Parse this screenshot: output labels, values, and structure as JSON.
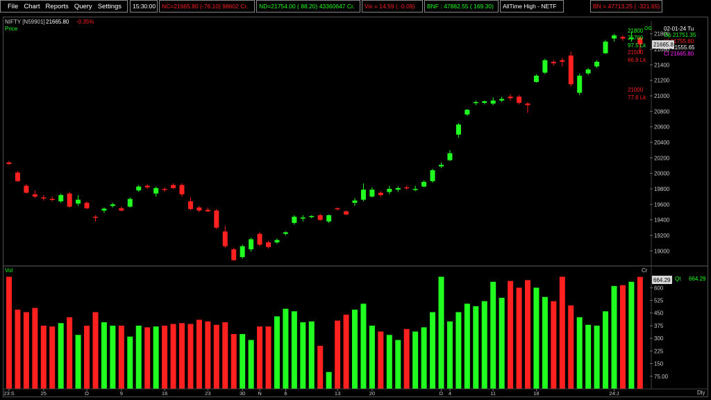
{
  "menu": {
    "items": [
      "File",
      "Chart",
      "Reports",
      "Query",
      "Settings"
    ]
  },
  "ticker": [
    {
      "text": "15:30:00",
      "color": "#ffffff"
    },
    {
      "text": "NC=21665.80  (-76.10) 98602 Cr.",
      "color": "#ff2020"
    },
    {
      "text": "ND=21754.00  ( 88.20) 43360647 Cr.",
      "color": "#20ff20"
    },
    {
      "text": "Vix =   14.59  ( -0.09)",
      "color": "#ff2020"
    },
    {
      "text": "BNF : 47882.55  ( 169.30)",
      "color": "#20ff20"
    },
    {
      "text": "AllTime High - NETF",
      "color": "#ffffff"
    },
    {
      "text": "BN = 47713.25  ( -321.65)",
      "color": "#ff2020"
    }
  ],
  "header": {
    "symbol": "NIFTY [N59901]",
    "price": "21665.80",
    "change": "-0.35%",
    "price_label": "Price"
  },
  "info_panel": {
    "date": "02-01-24 Tu",
    "open": "Op 21751.35",
    "high": "Hi 21755.60",
    "low": "Lo 21555.65",
    "close": "Cl  21665.80"
  },
  "volume_panel": {
    "label": "Vol",
    "cr_label": "Cr",
    "qt_label": "Qt",
    "qt_value": "664.29",
    "current": "664.29"
  },
  "levels": [
    {
      "price": "21800",
      "color": "#20ff20"
    },
    {
      "price": "21700",
      "color": "#20ff20"
    },
    {
      "price": "97.5 Lk",
      "color": "#20ff20"
    },
    {
      "price": "21500",
      "color": "#ff2020"
    },
    {
      "price": "66.9 Lk",
      "color": "#ff2020"
    },
    {
      "price": "21000",
      "color": "#ff2020"
    },
    {
      "price": "77.6 Lk",
      "color": "#ff2020"
    }
  ],
  "last_price_tag": "21665.8",
  "og_tag": "OG",
  "dly_label": "Dly",
  "colors": {
    "up": "#20ff20",
    "down": "#ff2020",
    "axis_text": "#c8c8c8",
    "info_hi": "#ff2020",
    "info_cl": "#ff20ff"
  },
  "chart_data": {
    "type": "candlestick",
    "price_axis": {
      "ticks": [
        19000,
        19200,
        19400,
        19600,
        19800,
        20000,
        20200,
        20400,
        20600,
        20800,
        21000,
        21200,
        21400,
        21600,
        21800
      ],
      "range": [
        18850,
        21950
      ]
    },
    "volume_axis": {
      "ticks": [
        "75.00",
        "150",
        "225",
        "300",
        "375",
        "450",
        "525",
        "600"
      ],
      "range": [
        0,
        700
      ]
    },
    "x_labels": [
      {
        "index": 0,
        "text": "23:S"
      },
      {
        "index": 4,
        "text": "25"
      },
      {
        "index": 9,
        "text": "O"
      },
      {
        "index": 13,
        "text": "9"
      },
      {
        "index": 18,
        "text": "16"
      },
      {
        "index": 23,
        "text": "23"
      },
      {
        "index": 27,
        "text": "30"
      },
      {
        "index": 29,
        "text": "N"
      },
      {
        "index": 32,
        "text": "6"
      },
      {
        "index": 38,
        "text": "13"
      },
      {
        "index": 42,
        "text": "20"
      },
      {
        "index": 50,
        "text": "D"
      },
      {
        "index": 51,
        "text": "4"
      },
      {
        "index": 56,
        "text": "11"
      },
      {
        "index": 61,
        "text": "18"
      },
      {
        "index": 70,
        "text": "24:J"
      }
    ],
    "candles": [
      {
        "o": 20140,
        "h": 20160,
        "l": 20110,
        "c": 20120,
        "v": 665
      },
      {
        "o": 20010,
        "h": 20030,
        "l": 19890,
        "c": 19900,
        "v": 470
      },
      {
        "o": 19840,
        "h": 19860,
        "l": 19740,
        "c": 19750,
        "v": 455
      },
      {
        "o": 19730,
        "h": 19780,
        "l": 19680,
        "c": 19700,
        "v": 480
      },
      {
        "o": 19690,
        "h": 19720,
        "l": 19650,
        "c": 19680,
        "v": 375
      },
      {
        "o": 19670,
        "h": 19700,
        "l": 19640,
        "c": 19660,
        "v": 370
      },
      {
        "o": 19640,
        "h": 19740,
        "l": 19620,
        "c": 19720,
        "v": 390
      },
      {
        "o": 19740,
        "h": 19760,
        "l": 19560,
        "c": 19570,
        "v": 425
      },
      {
        "o": 19610,
        "h": 19720,
        "l": 19580,
        "c": 19660,
        "v": 320
      },
      {
        "o": 19620,
        "h": 19640,
        "l": 19540,
        "c": 19550,
        "v": 375
      },
      {
        "o": 19440,
        "h": 19460,
        "l": 19380,
        "c": 19430,
        "v": 455
      },
      {
        "o": 19520,
        "h": 19560,
        "l": 19490,
        "c": 19545,
        "v": 395
      },
      {
        "o": 19580,
        "h": 19620,
        "l": 19560,
        "c": 19600,
        "v": 375
      },
      {
        "o": 19550,
        "h": 19570,
        "l": 19510,
        "c": 19520,
        "v": 375
      },
      {
        "o": 19570,
        "h": 19690,
        "l": 19560,
        "c": 19670,
        "v": 310
      },
      {
        "o": 19780,
        "h": 19850,
        "l": 19760,
        "c": 19830,
        "v": 375
      },
      {
        "o": 19840,
        "h": 19860,
        "l": 19800,
        "c": 19820,
        "v": 365
      },
      {
        "o": 19740,
        "h": 19830,
        "l": 19700,
        "c": 19810,
        "v": 370
      },
      {
        "o": 19800,
        "h": 19820,
        "l": 19760,
        "c": 19790,
        "v": 375
      },
      {
        "o": 19850,
        "h": 19870,
        "l": 19800,
        "c": 19810,
        "v": 385
      },
      {
        "o": 19850,
        "h": 19870,
        "l": 19700,
        "c": 19730,
        "v": 390
      },
      {
        "o": 19640,
        "h": 19690,
        "l": 19520,
        "c": 19540,
        "v": 385
      },
      {
        "o": 19560,
        "h": 19580,
        "l": 19500,
        "c": 19520,
        "v": 410
      },
      {
        "o": 19530,
        "h": 19560,
        "l": 19500,
        "c": 19510,
        "v": 400
      },
      {
        "o": 19520,
        "h": 19540,
        "l": 19280,
        "c": 19300,
        "v": 380
      },
      {
        "o": 19250,
        "h": 19320,
        "l": 19040,
        "c": 19060,
        "v": 395
      },
      {
        "o": 19020,
        "h": 19040,
        "l": 18870,
        "c": 18880,
        "v": 325
      },
      {
        "o": 18920,
        "h": 19080,
        "l": 18900,
        "c": 19060,
        "v": 325
      },
      {
        "o": 19020,
        "h": 19170,
        "l": 18990,
        "c": 19150,
        "v": 290
      },
      {
        "o": 19220,
        "h": 19240,
        "l": 19060,
        "c": 19080,
        "v": 370
      },
      {
        "o": 19110,
        "h": 19130,
        "l": 19030,
        "c": 19050,
        "v": 370
      },
      {
        "o": 19110,
        "h": 19160,
        "l": 19090,
        "c": 19140,
        "v": 430
      },
      {
        "o": 19220,
        "h": 19250,
        "l": 19200,
        "c": 19240,
        "v": 475
      },
      {
        "o": 19360,
        "h": 19460,
        "l": 19340,
        "c": 19440,
        "v": 460
      },
      {
        "o": 19420,
        "h": 19460,
        "l": 19380,
        "c": 19430,
        "v": 395
      },
      {
        "o": 19440,
        "h": 19460,
        "l": 19420,
        "c": 19450,
        "v": 400
      },
      {
        "o": 19460,
        "h": 19480,
        "l": 19390,
        "c": 19400,
        "v": 255
      },
      {
        "o": 19380,
        "h": 19470,
        "l": 19360,
        "c": 19460,
        "v": 100
      },
      {
        "o": 19550,
        "h": 19560,
        "l": 19520,
        "c": 19540,
        "v": 405
      },
      {
        "o": 19510,
        "h": 19520,
        "l": 19460,
        "c": 19470,
        "v": 440
      },
      {
        "o": 19620,
        "h": 19680,
        "l": 19580,
        "c": 19650,
        "v": 470
      },
      {
        "o": 19660,
        "h": 19870,
        "l": 19640,
        "c": 19790,
        "v": 505
      },
      {
        "o": 19700,
        "h": 19820,
        "l": 19690,
        "c": 19790,
        "v": 375
      },
      {
        "o": 19750,
        "h": 19770,
        "l": 19700,
        "c": 19720,
        "v": 340
      },
      {
        "o": 19760,
        "h": 19840,
        "l": 19730,
        "c": 19800,
        "v": 320
      },
      {
        "o": 19790,
        "h": 19830,
        "l": 19760,
        "c": 19810,
        "v": 290
      },
      {
        "o": 19820,
        "h": 19840,
        "l": 19790,
        "c": 19810,
        "v": 355
      },
      {
        "o": 19790,
        "h": 19840,
        "l": 19770,
        "c": 19800,
        "v": 340
      },
      {
        "o": 19830,
        "h": 19910,
        "l": 19820,
        "c": 19890,
        "v": 365
      },
      {
        "o": 19900,
        "h": 20060,
        "l": 19880,
        "c": 20040,
        "v": 455
      },
      {
        "o": 20090,
        "h": 20140,
        "l": 20070,
        "c": 20110,
        "v": 665
      },
      {
        "o": 20170,
        "h": 20300,
        "l": 20160,
        "c": 20260,
        "v": 400
      },
      {
        "o": 20500,
        "h": 20650,
        "l": 20460,
        "c": 20630,
        "v": 455
      },
      {
        "o": 20760,
        "h": 20830,
        "l": 20740,
        "c": 20820,
        "v": 505
      },
      {
        "o": 20910,
        "h": 20940,
        "l": 20880,
        "c": 20920,
        "v": 490
      },
      {
        "o": 20910,
        "h": 20940,
        "l": 20890,
        "c": 20930,
        "v": 520
      },
      {
        "o": 20900,
        "h": 20980,
        "l": 20880,
        "c": 20940,
        "v": 635
      },
      {
        "o": 20940,
        "h": 20990,
        "l": 20920,
        "c": 20960,
        "v": 540
      },
      {
        "o": 20990,
        "h": 21020,
        "l": 20940,
        "c": 20970,
        "v": 640
      },
      {
        "o": 20990,
        "h": 21010,
        "l": 20890,
        "c": 20910,
        "v": 600
      },
      {
        "o": 20900,
        "h": 20920,
        "l": 20780,
        "c": 20880,
        "v": 645
      },
      {
        "o": 21180,
        "h": 21280,
        "l": 21170,
        "c": 21260,
        "v": 600
      },
      {
        "o": 21300,
        "h": 21480,
        "l": 21280,
        "c": 21460,
        "v": 545
      },
      {
        "o": 21440,
        "h": 21460,
        "l": 21390,
        "c": 21420,
        "v": 520
      },
      {
        "o": 21460,
        "h": 21490,
        "l": 21380,
        "c": 21440,
        "v": 665
      },
      {
        "o": 21520,
        "h": 21570,
        "l": 21120,
        "c": 21150,
        "v": 495
      },
      {
        "o": 21040,
        "h": 21290,
        "l": 21010,
        "c": 21260,
        "v": 425
      },
      {
        "o": 21290,
        "h": 21360,
        "l": 21270,
        "c": 21340,
        "v": 380
      },
      {
        "o": 21380,
        "h": 21460,
        "l": 21360,
        "c": 21440,
        "v": 375
      },
      {
        "o": 21550,
        "h": 21720,
        "l": 21540,
        "c": 21700,
        "v": 460
      },
      {
        "o": 21740,
        "h": 21800,
        "l": 21700,
        "c": 21780,
        "v": 610
      },
      {
        "o": 21760,
        "h": 21780,
        "l": 21710,
        "c": 21740,
        "v": 615
      },
      {
        "o": 21740,
        "h": 21830,
        "l": 21700,
        "c": 21750,
        "v": 635
      },
      {
        "o": 21751,
        "h": 21756,
        "l": 21556,
        "c": 21666,
        "v": 664
      }
    ]
  }
}
